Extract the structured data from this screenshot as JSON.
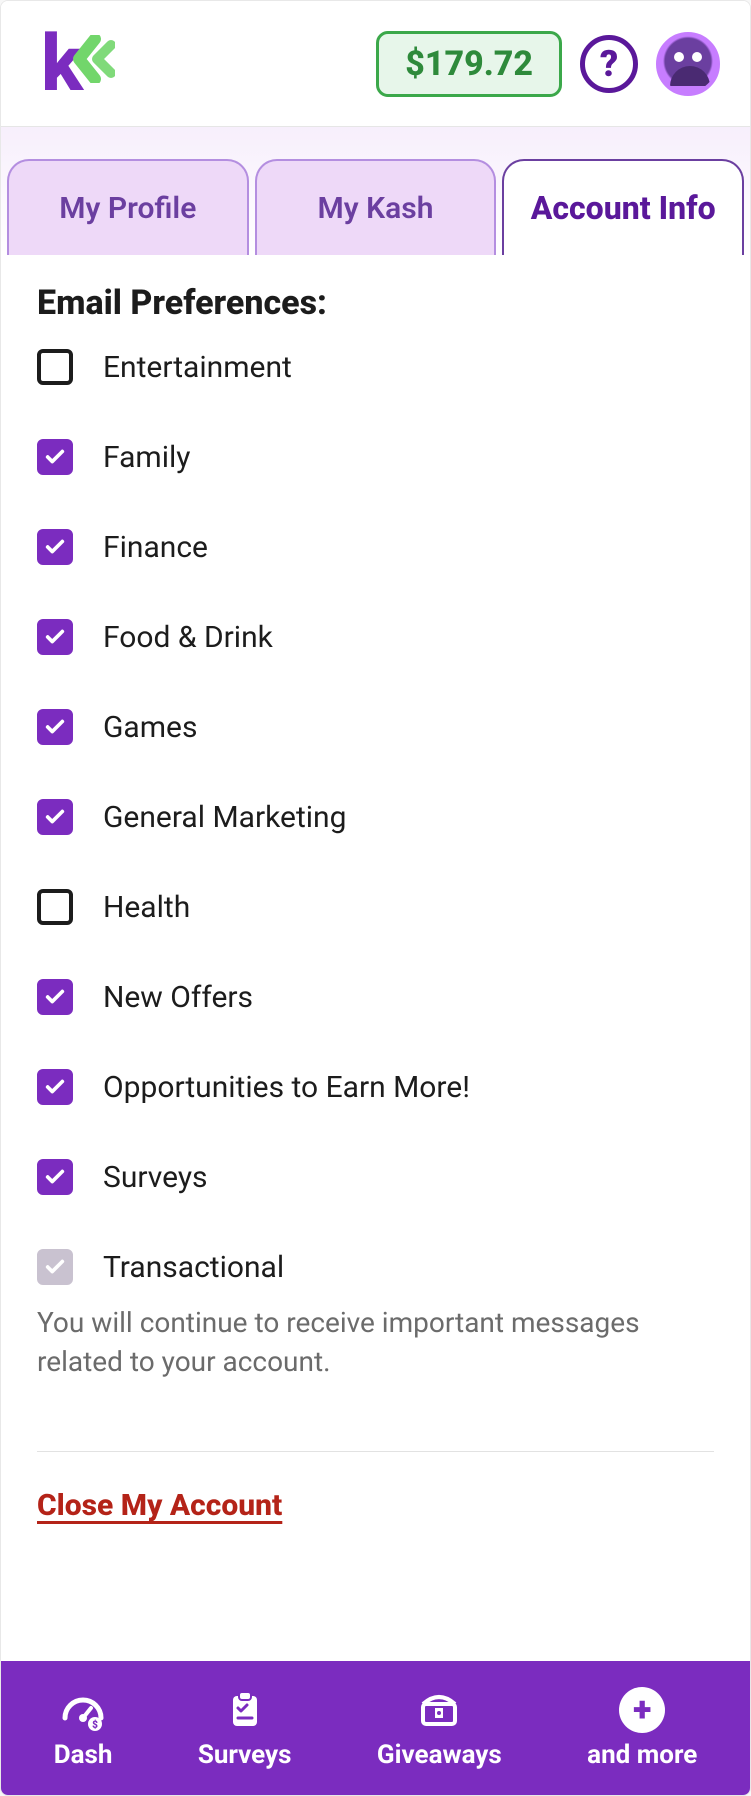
{
  "header": {
    "balance": "$179.72"
  },
  "tabs": [
    {
      "label": "My Profile",
      "active": false
    },
    {
      "label": "My Kash",
      "active": false
    },
    {
      "label": "Account Info",
      "active": true
    }
  ],
  "section": {
    "title": "Email Preferences:",
    "disclaimer": "You will continue to receive important messages related to your account.",
    "close_link": "Close My Account"
  },
  "preferences": [
    {
      "label": "Entertainment",
      "checked": false,
      "disabled": false
    },
    {
      "label": "Family",
      "checked": true,
      "disabled": false
    },
    {
      "label": "Finance",
      "checked": true,
      "disabled": false
    },
    {
      "label": "Food & Drink",
      "checked": true,
      "disabled": false
    },
    {
      "label": "Games",
      "checked": true,
      "disabled": false
    },
    {
      "label": "General Marketing",
      "checked": true,
      "disabled": false
    },
    {
      "label": "Health",
      "checked": false,
      "disabled": false
    },
    {
      "label": "New Offers",
      "checked": true,
      "disabled": false
    },
    {
      "label": "Opportunities to Earn More!",
      "checked": true,
      "disabled": false
    },
    {
      "label": "Surveys",
      "checked": true,
      "disabled": false
    },
    {
      "label": "Transactional",
      "checked": true,
      "disabled": true
    }
  ],
  "nav": [
    {
      "label": "Dash"
    },
    {
      "label": "Surveys"
    },
    {
      "label": "Giveaways"
    },
    {
      "label": "and more"
    }
  ]
}
